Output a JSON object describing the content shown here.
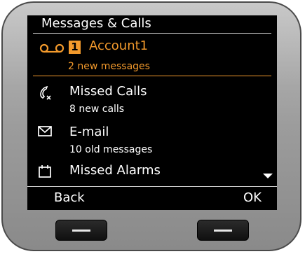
{
  "screen": {
    "title": "Messages & Calls"
  },
  "account": {
    "badge": "1",
    "name": "Account1",
    "summary": "2 new messages",
    "icon": "voicemail-icon"
  },
  "items": [
    {
      "label": "Missed Calls",
      "summary": "8 new calls",
      "icon": "missed-call-icon"
    },
    {
      "label": "E-mail",
      "summary": "10 old messages",
      "icon": "envelope-icon"
    },
    {
      "label": "Missed Alarms",
      "summary": "",
      "icon": "alarm-calendar-icon"
    }
  ],
  "softkeys": {
    "left": "Back",
    "right": "OK"
  },
  "colors": {
    "accent": "#f39a2c",
    "screen_bg": "#000000",
    "text": "#ffffff"
  }
}
